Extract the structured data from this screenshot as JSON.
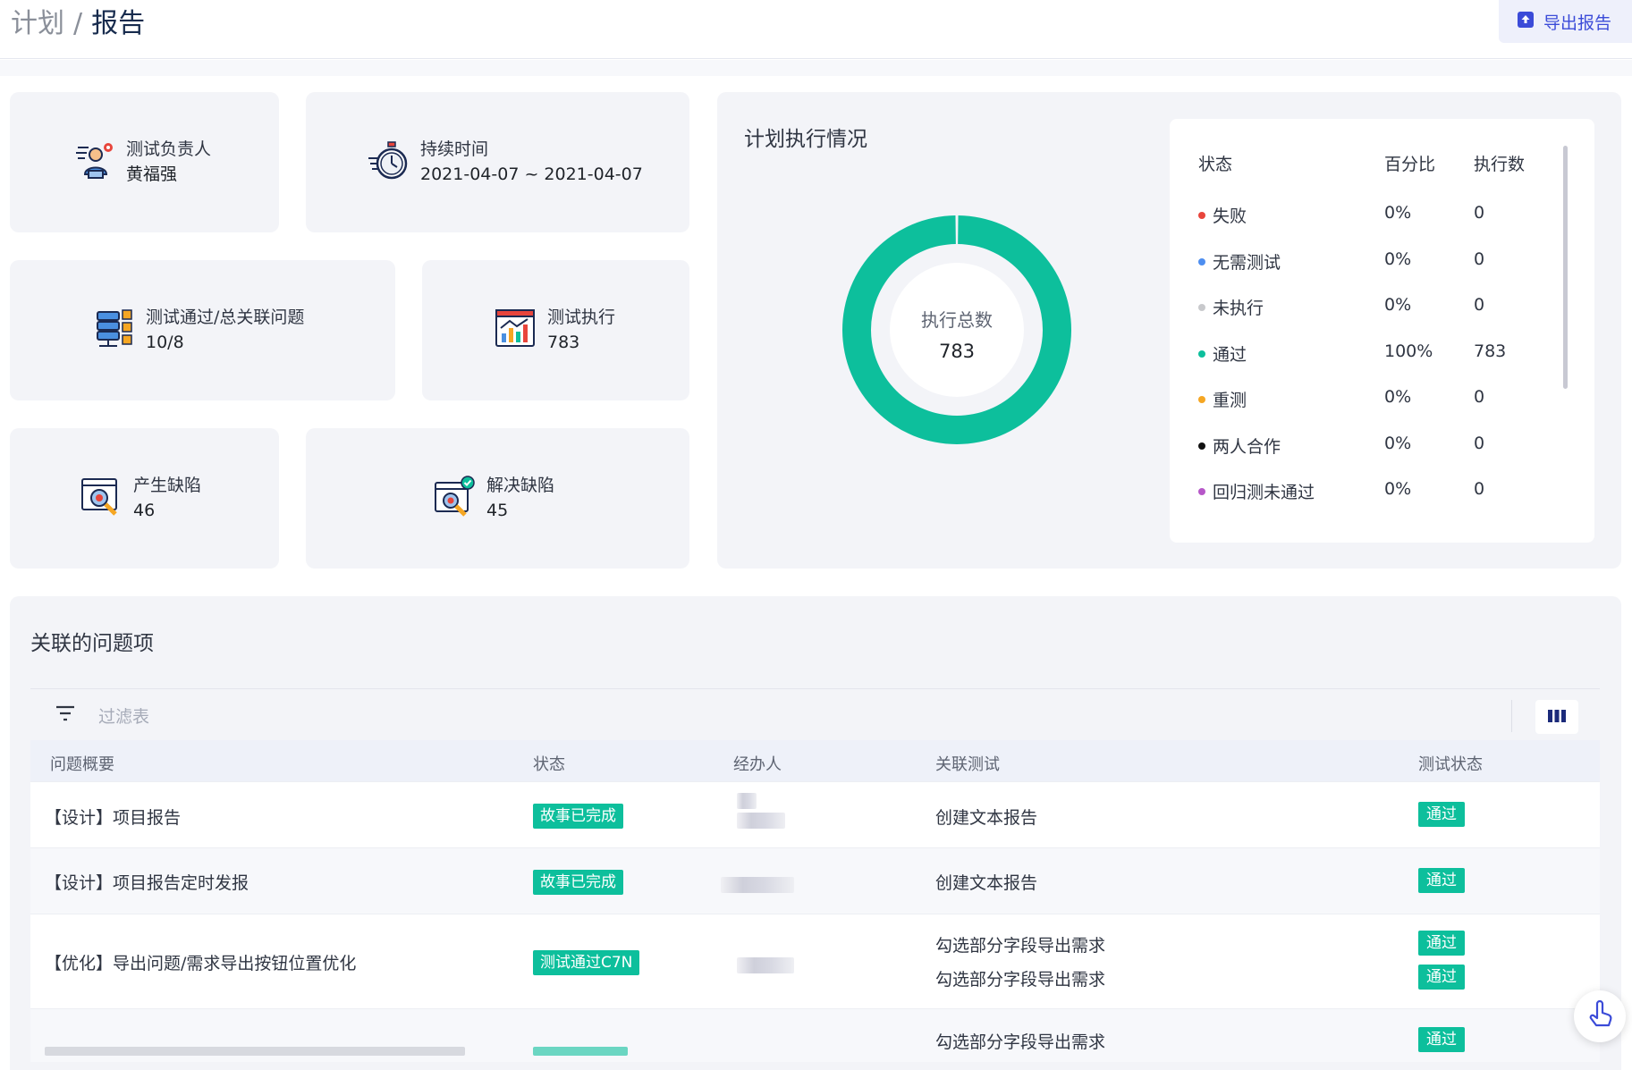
{
  "breadcrumb": {
    "parent": "计划",
    "separator": "/",
    "current": "报告"
  },
  "header": {
    "export_label": "导出报告"
  },
  "stats": {
    "owner": {
      "title": "测试负责人",
      "value": "黄福强",
      "icon": "tester-person-icon"
    },
    "duration": {
      "title": "持续时间",
      "value": "2021-04-07 ~ 2021-04-07",
      "icon": "stopwatch-icon"
    },
    "pass_issues": {
      "title": "测试通过/总关联问题",
      "value": "10/8",
      "icon": "database-stack-icon"
    },
    "executions": {
      "title": "测试执行",
      "value": "783",
      "icon": "chart-board-icon"
    },
    "defects_created": {
      "title": "产生缺陷",
      "value": "46",
      "icon": "bug-search-icon"
    },
    "defects_resolved": {
      "title": "解决缺陷",
      "value": "45",
      "icon": "bug-resolved-icon"
    }
  },
  "execution": {
    "title": "计划执行情况",
    "center_label": "执行总数",
    "center_value": "783",
    "legend_headers": {
      "status": "状态",
      "percent": "百分比",
      "count": "执行数"
    },
    "legend": [
      {
        "name": "失败",
        "percent": "0%",
        "count": "0",
        "color": "#e8453c"
      },
      {
        "name": "无需测试",
        "percent": "0%",
        "count": "0",
        "color": "#4d8ef0"
      },
      {
        "name": "未执行",
        "percent": "0%",
        "count": "0",
        "color": "#c8c9cc"
      },
      {
        "name": "通过",
        "percent": "100%",
        "count": "783",
        "color": "#0dbf9c"
      },
      {
        "name": "重测",
        "percent": "0%",
        "count": "0",
        "color": "#f5a623"
      },
      {
        "name": "两人合作",
        "percent": "0%",
        "count": "0",
        "color": "#111111"
      },
      {
        "name": "回归测未通过",
        "percent": "0%",
        "count": "0",
        "color": "#b657c8"
      }
    ]
  },
  "chart_data": {
    "type": "pie",
    "categories": [
      "失败",
      "无需测试",
      "未执行",
      "通过",
      "重测",
      "两人合作",
      "回归测未通过"
    ],
    "values": [
      0,
      0,
      0,
      783,
      0,
      0,
      0
    ],
    "colors": [
      "#e8453c",
      "#4d8ef0",
      "#c8c9cc",
      "#0dbf9c",
      "#f5a623",
      "#111111",
      "#b657c8"
    ],
    "title": "计划执行情况"
  },
  "issues": {
    "title": "关联的问题项",
    "filter_placeholder": "过滤表",
    "columns": {
      "summary": "问题概要",
      "status": "状态",
      "assignee": "经办人",
      "tests": "关联测试",
      "test_status": "测试状态"
    },
    "rows": [
      {
        "summary": "【设计】项目报告",
        "status": "故事已完成",
        "tests": [
          {
            "name": "创建文本报告",
            "status": "通过"
          }
        ]
      },
      {
        "summary": "【设计】项目报告定时发报",
        "status": "故事已完成",
        "tests": [
          {
            "name": "创建文本报告",
            "status": "通过"
          }
        ]
      },
      {
        "summary": "【优化】导出问题/需求导出按钮位置优化",
        "status": "测试通过C7N",
        "tests": [
          {
            "name": "勾选部分字段导出需求",
            "status": "通过"
          },
          {
            "name": "勾选部分字段导出需求",
            "status": "通过"
          }
        ]
      },
      {
        "summary": "",
        "status": "",
        "tests": [
          {
            "name": "勾选部分字段导出需求",
            "status": "通过"
          }
        ]
      }
    ]
  }
}
